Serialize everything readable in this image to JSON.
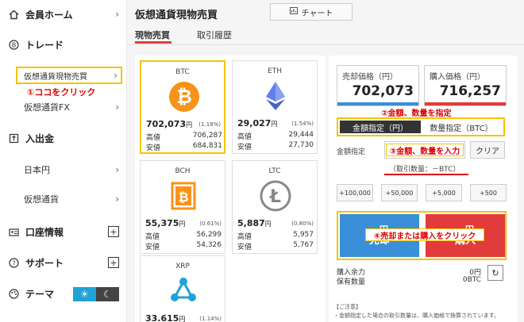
{
  "sidebar": {
    "member_home": "会員ホーム",
    "trade": "トレード",
    "spot_trading": "仮想通貨現物売買",
    "click_here_note": "①ココをクリック",
    "fx": "仮想通貨FX",
    "deposit_withdraw": "入出金",
    "jpy": "日本円",
    "crypto": "仮想通貨",
    "account_info": "口座情報",
    "support": "サポート",
    "theme": "テーマ"
  },
  "main": {
    "title": "仮想通貨現物売買",
    "chart_button": "チャート",
    "tabs": [
      "現物売買",
      "取引履歴"
    ]
  },
  "coins": [
    {
      "name": "BTC",
      "price": "702,073",
      "unit": "円",
      "change": "(1.18%)",
      "high_label": "高値",
      "high": "706,287",
      "low_label": "安値",
      "low": "684,831",
      "color": "#f7931a"
    },
    {
      "name": "ETH",
      "price": "29,027",
      "unit": "円",
      "change": "(1.54%)",
      "high_label": "高値",
      "high": "29,444",
      "low_label": "安値",
      "low": "27,730",
      "color": "#627eea"
    },
    {
      "name": "BCH",
      "price": "55,375",
      "unit": "円",
      "change": "(0.61%)",
      "high_label": "高値",
      "high": "56,299",
      "low_label": "安値",
      "low": "54,326",
      "color": "#f7931a"
    },
    {
      "name": "LTC",
      "price": "5,887",
      "unit": "円",
      "change": "(0.80%)",
      "high_label": "高値",
      "high": "5,957",
      "low_label": "安値",
      "low": "5,767",
      "color": "#888888"
    },
    {
      "name": "XRP",
      "price": "33.615",
      "unit": "円",
      "change": "(1.14%)",
      "color": "#1fa3d6"
    }
  ],
  "trade": {
    "sell_price_label": "売却価格（円）",
    "sell_price": "702,073",
    "buy_price_label": "購入価格（円）",
    "buy_price": "716,257",
    "note2": "②金額、数量を指定",
    "mode_amount": "金額指定（円）",
    "mode_quantity": "数量指定（BTC）",
    "amount_label": "金額指定",
    "note3": "③金額、数量を入力",
    "clear": "クリア",
    "trade_qty": "（取引数量：－BTC）",
    "steps": [
      "+100,000",
      "+50,000",
      "+5,000",
      "+500"
    ],
    "sell_top": "－円",
    "sell_label": "売却",
    "buy_top": "－円",
    "buy_label": "購入",
    "note4": "④売却または購入をクリック",
    "buying_power_label": "購入余力",
    "buying_power": "0円",
    "holdings_label": "保有数量",
    "holdings": "0BTC",
    "notice_title": "【ご注意】",
    "notice_text": "・金額指定した場合の取引数量は、購入価格で換算されています。"
  },
  "colors": {
    "accent_yellow": "#f5c400",
    "sell_blue": "#3a8fd9",
    "buy_red": "#e23b3b",
    "note_red": "#e00000"
  }
}
